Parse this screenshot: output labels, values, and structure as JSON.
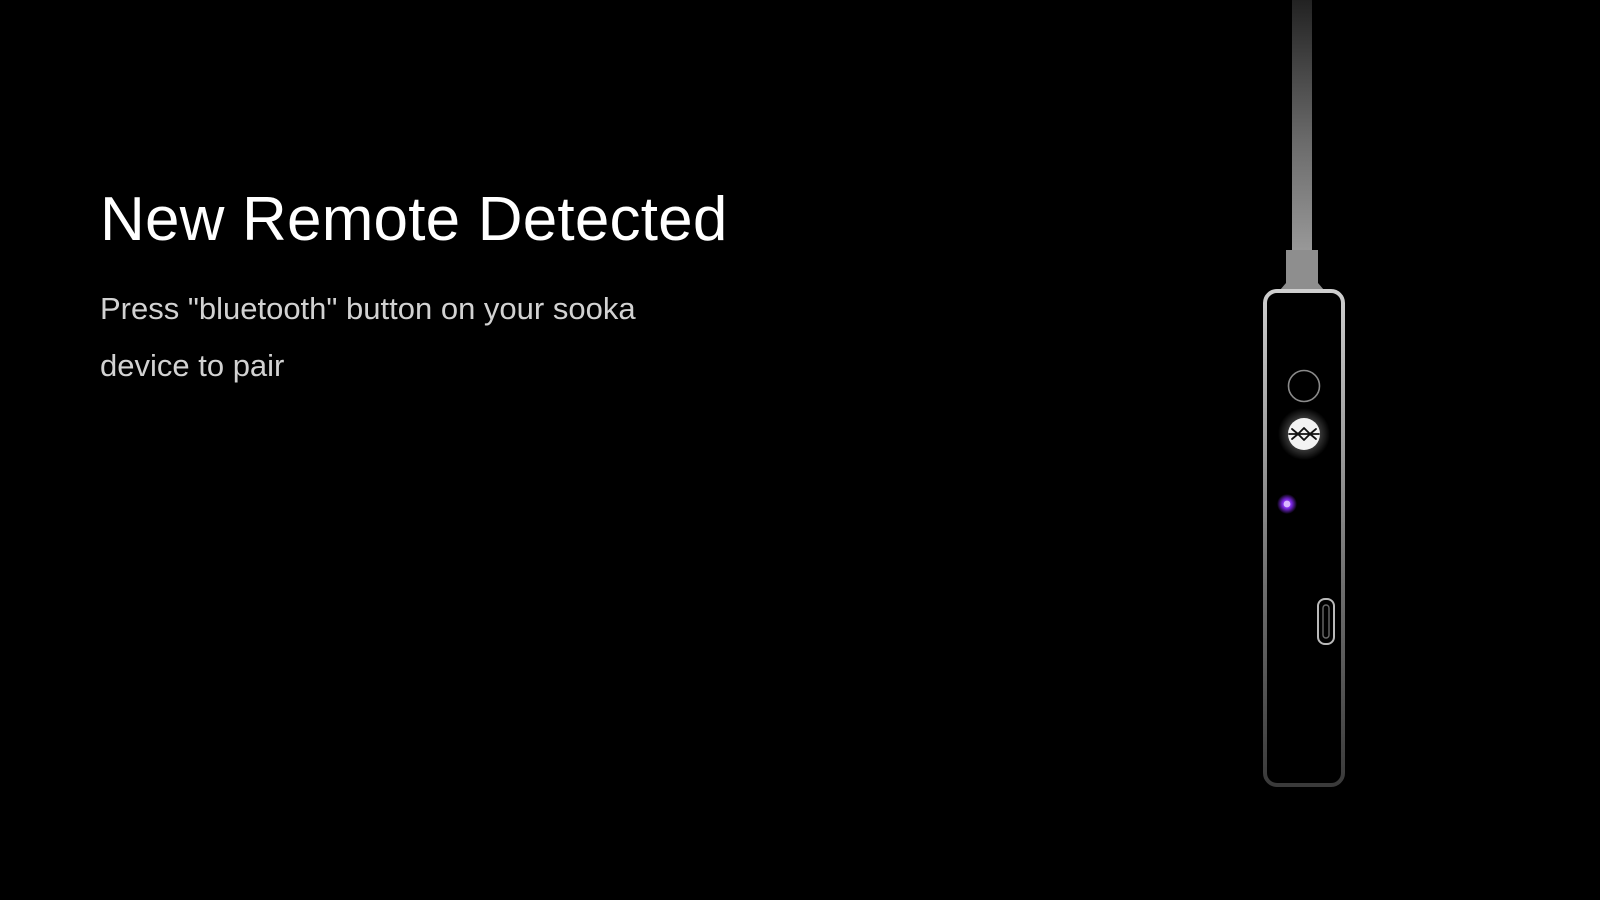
{
  "pairing_screen": {
    "title": "New Remote Detected",
    "instruction": "Press \"bluetooth\" button on your sooka device to pair"
  },
  "device_illustration": {
    "buttons": [
      {
        "name": "power-button",
        "icon": "blank-circle"
      },
      {
        "name": "bluetooth-button",
        "icon": "bluetooth-icon",
        "highlighted": true
      }
    ],
    "indicator_light": {
      "color": "#8a2cff",
      "state": "on"
    },
    "usb_port": true
  },
  "colors": {
    "background": "#000000",
    "title": "#ffffff",
    "instruction": "#d2d2d2",
    "indicator": "#8a2cff"
  }
}
